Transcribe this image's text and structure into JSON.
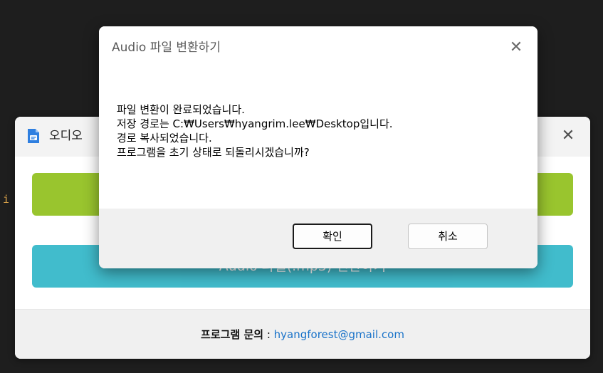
{
  "background_window": {
    "title": "오디오",
    "close_glyph": "✕",
    "green_button_label": "",
    "teal_button_label": "Audio 파일(.mp3) 변환하기",
    "footer": {
      "label": "프로그램 문의",
      "separator": " : ",
      "email": "hyangforest@gmail.com"
    },
    "edge_glyph": "i"
  },
  "dialog": {
    "title": "Audio 파일 변환하기",
    "close_glyph": "✕",
    "message_lines": [
      "파일 변환이 완료되었습니다.",
      "저장 경로는 C:₩Users₩hyangrim.lee₩Desktop입니다.",
      "경로 복사되었습니다.",
      "프로그램을 초기 상태로 되돌리시겠습니까?"
    ],
    "confirm_label": "확인",
    "cancel_label": "취소"
  },
  "colors": {
    "green_button": "#99c52e",
    "teal_button": "#31b6c8",
    "email_link": "#1a73c9",
    "desktop": "#1e1e1e"
  },
  "icons": {
    "app_icon": "document-file-icon",
    "close": "close-icon"
  }
}
